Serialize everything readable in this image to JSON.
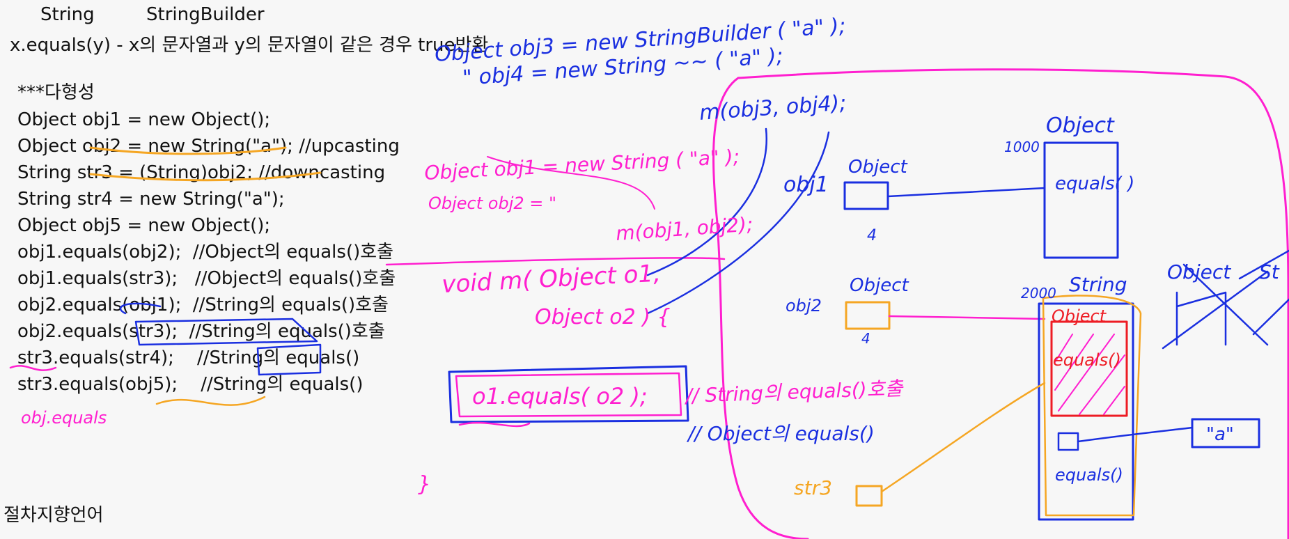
{
  "header": {
    "class_string": "String",
    "class_stringbuilder": "StringBuilder",
    "equals_desc": "x.equals(y) - x의 문자열과 y의 문자열이 같은 경우 true반환"
  },
  "code": {
    "heading": "***다형성",
    "lines": [
      "Object obj1 = new Object();",
      "Object obj2 = new String(\"a\"); //upcasting",
      "String str3 = (String)obj2; //downcasting",
      "String str4 = new String(\"a\");",
      "Object obj5 = new Object();",
      "obj1.equals(obj2);  //Object의 equals()호출",
      "obj1.equals(str3);   //Object의 equals()호출",
      "obj2.equals(obj1);  //String의 equals()호출",
      "obj2.equals(str3);  //String의 equals()호출",
      "str3.equals(str4);    //String의 equals()",
      "str3.equals(obj5);    //String의 equals()"
    ]
  },
  "footer": {
    "procedural": "절차지향언어"
  },
  "annotations": {
    "blue": {
      "obj3_decl": "Object  obj3 = new StringBuilder ( \"a\" );",
      "obj4_decl": "\"       obj4  = new String ~~ ( \"a\" );",
      "m_call_34": "m(obj3, obj4);",
      "obj1_label": "obj1",
      "obj1_object": "Object",
      "obj1_addr": "4",
      "obj2_label": "obj2",
      "obj2_object": "Object",
      "obj2_addr": "4",
      "heap_addr_1000": "1000",
      "heap_object": "Object",
      "heap_equals": "equals( )",
      "heap_addr_2000": "2000",
      "heap_string": "String",
      "a_literal": "\"a\"",
      "object_equals_comment": "// Object의 equals()",
      "object_right": "Object",
      "st_right": "St"
    },
    "magenta": {
      "obj1_new": "Object  obj1 = new String ( \"a\" );",
      "obj2_new": "Object  obj2 =     \"",
      "m_call_12": "m(obj1, obj2);",
      "void_m": "void  m( Object o1,",
      "object_o2": "Object  o2 ) {",
      "o1_equals": "o1.equals( o2 );",
      "string_equals_comment": "// String의 equals()호출",
      "brace_close": "}",
      "obj_equals": "obj.equals"
    },
    "orange": {
      "str3": "str3",
      "heap_equals_bottom": "equals()"
    },
    "red": {
      "heap_object_red": "Object",
      "heap_equals_red": "equals()"
    }
  },
  "colors": {
    "blue_ink": "#1a2fe0",
    "magenta_ink": "#ff1fcf",
    "orange_ink": "#f5a623",
    "red_ink": "#ee1c24",
    "text": "#111111",
    "background": "#f7f7f7"
  }
}
